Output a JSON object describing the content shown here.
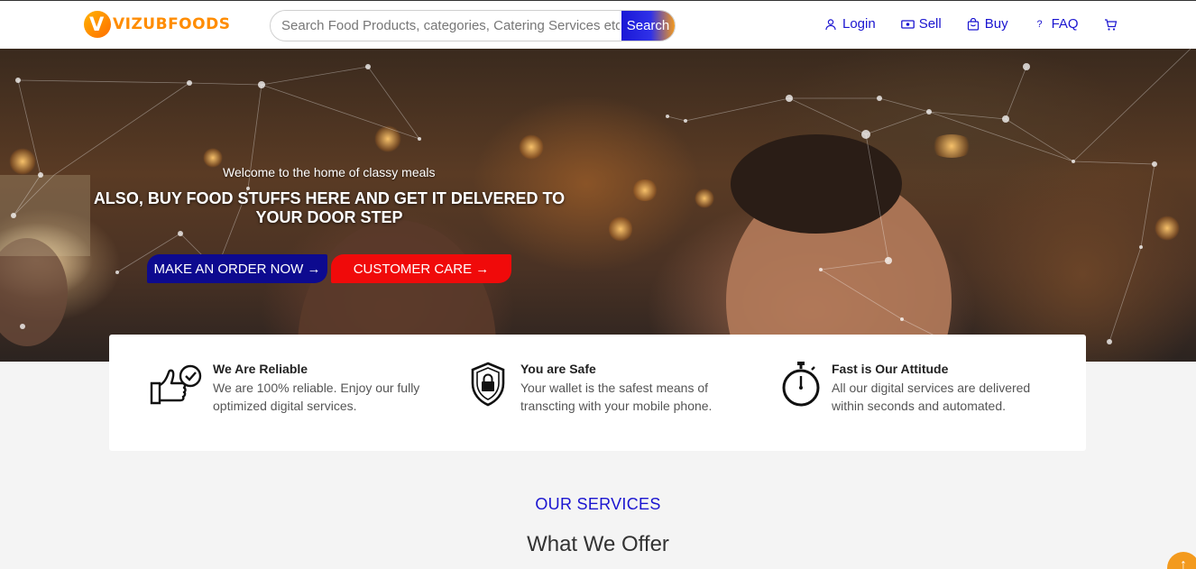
{
  "header": {
    "logo_text": "VIZUBFOODS",
    "search_placeholder": "Search Food Products, categories, Catering Services etc...",
    "search_button": "Search",
    "nav": {
      "login": "Login",
      "sell": "Sell",
      "buy": "Buy",
      "faq": "FAQ"
    },
    "colors": {
      "brand_orange": "#ff8c00",
      "link_blue": "#1a14d0"
    }
  },
  "hero": {
    "subtitle": "Welcome to the home of classy meals",
    "title": "ALSO, BUY FOOD STUFFS HERE AND GET IT DELVERED TO YOUR DOOR STEP",
    "order_button": "MAKE AN ORDER NOW →",
    "care_button": "CUSTOMER CARE →",
    "colors": {
      "order_bg": "#0d0a8f",
      "care_bg": "#f00a0a"
    }
  },
  "features": [
    {
      "icon": "thumbs-up-check-icon",
      "title": "We Are Reliable",
      "text": "We are 100% reliable. Enjoy our fully optimized digital services."
    },
    {
      "icon": "shield-lock-icon",
      "title": "You are Safe",
      "text": "Your wallet is the safest means of transcting with your mobile phone."
    },
    {
      "icon": "stopwatch-icon",
      "title": "Fast is Our Attitude",
      "text": "All our digital services are delivered within seconds and automated."
    }
  ],
  "services": {
    "label": "OUR SERVICES",
    "title": "What We Offer"
  },
  "scroll_top": "↑"
}
